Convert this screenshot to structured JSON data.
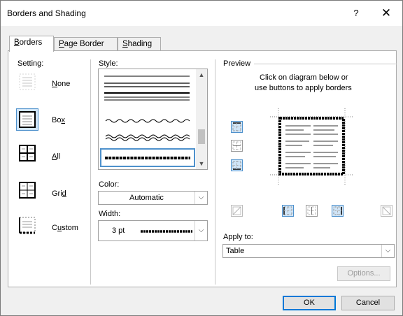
{
  "dialog": {
    "title": "Borders and Shading",
    "help_label": "?",
    "close_label": "✕"
  },
  "tabs": [
    {
      "label_u": "B",
      "label_rest": "orders",
      "active": true
    },
    {
      "label_u": "P",
      "label_rest": "age Border",
      "active": false
    },
    {
      "label_u": "S",
      "label_rest": "hading",
      "active": false
    }
  ],
  "setting": {
    "heading": "Setting:",
    "items": [
      {
        "label": "None",
        "u": "N",
        "selected": false
      },
      {
        "label": "Box",
        "u": "x",
        "selected": true
      },
      {
        "label": "All",
        "u": "A",
        "selected": false
      },
      {
        "label": "Grid",
        "u": "d",
        "selected": false
      },
      {
        "label": "Custom",
        "u": "u",
        "selected": false
      }
    ]
  },
  "style": {
    "heading": "Style:",
    "scroll_up": "▲",
    "scroll_down": "▼"
  },
  "color": {
    "heading": "Color:",
    "value": "Automatic"
  },
  "width": {
    "heading": "Width:",
    "value": "3 pt"
  },
  "preview": {
    "heading": "Preview",
    "hint_line1": "Click on diagram below or",
    "hint_line2": "use buttons to apply borders"
  },
  "apply_to": {
    "heading": "Apply to:",
    "value": "Table"
  },
  "buttons": {
    "options": "Options...",
    "ok": "OK",
    "cancel": "Cancel"
  },
  "colors": {
    "accent": "#0078d7",
    "selected_bg": "#cfe4f7"
  }
}
